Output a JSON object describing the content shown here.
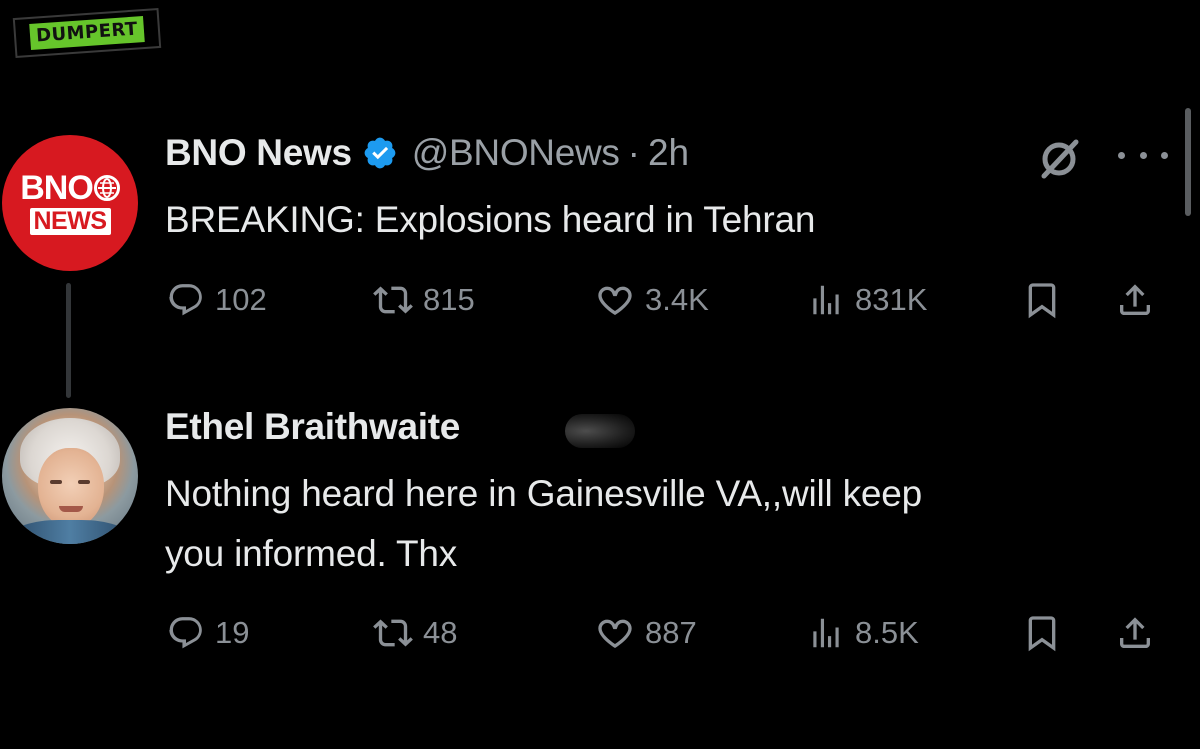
{
  "watermark": {
    "text": "DUMPERT"
  },
  "tweet": {
    "avatar": {
      "line1": "BNO",
      "line2": "NEWS"
    },
    "name": "BNO News",
    "handle": "@BNONews",
    "separator": "·",
    "time": "2h",
    "text": "BREAKING: Explosions heard in Tehran",
    "stats": {
      "replies": "102",
      "retweets": "815",
      "likes": "3.4K",
      "views": "831K"
    },
    "icons": [
      "reply-icon",
      "retweet-icon",
      "like-icon",
      "views-icon",
      "bookmark-icon",
      "share-icon",
      "grok-icon",
      "more-icon",
      "verified-badge-icon"
    ]
  },
  "reply": {
    "name": "Ethel Braithwaite",
    "text_line1": "Nothing heard here in Gainesville VA,,will keep",
    "text_line2": "you informed. Thx",
    "stats": {
      "replies": "19",
      "retweets": "48",
      "likes": "887",
      "views": "8.5K"
    }
  },
  "colors": {
    "background": "#000000",
    "text": "#e7e9ea",
    "muted": "#8b9096",
    "verified": "#1d9bf0",
    "bno_red": "#d71920",
    "watermark_green": "#66c52b"
  }
}
